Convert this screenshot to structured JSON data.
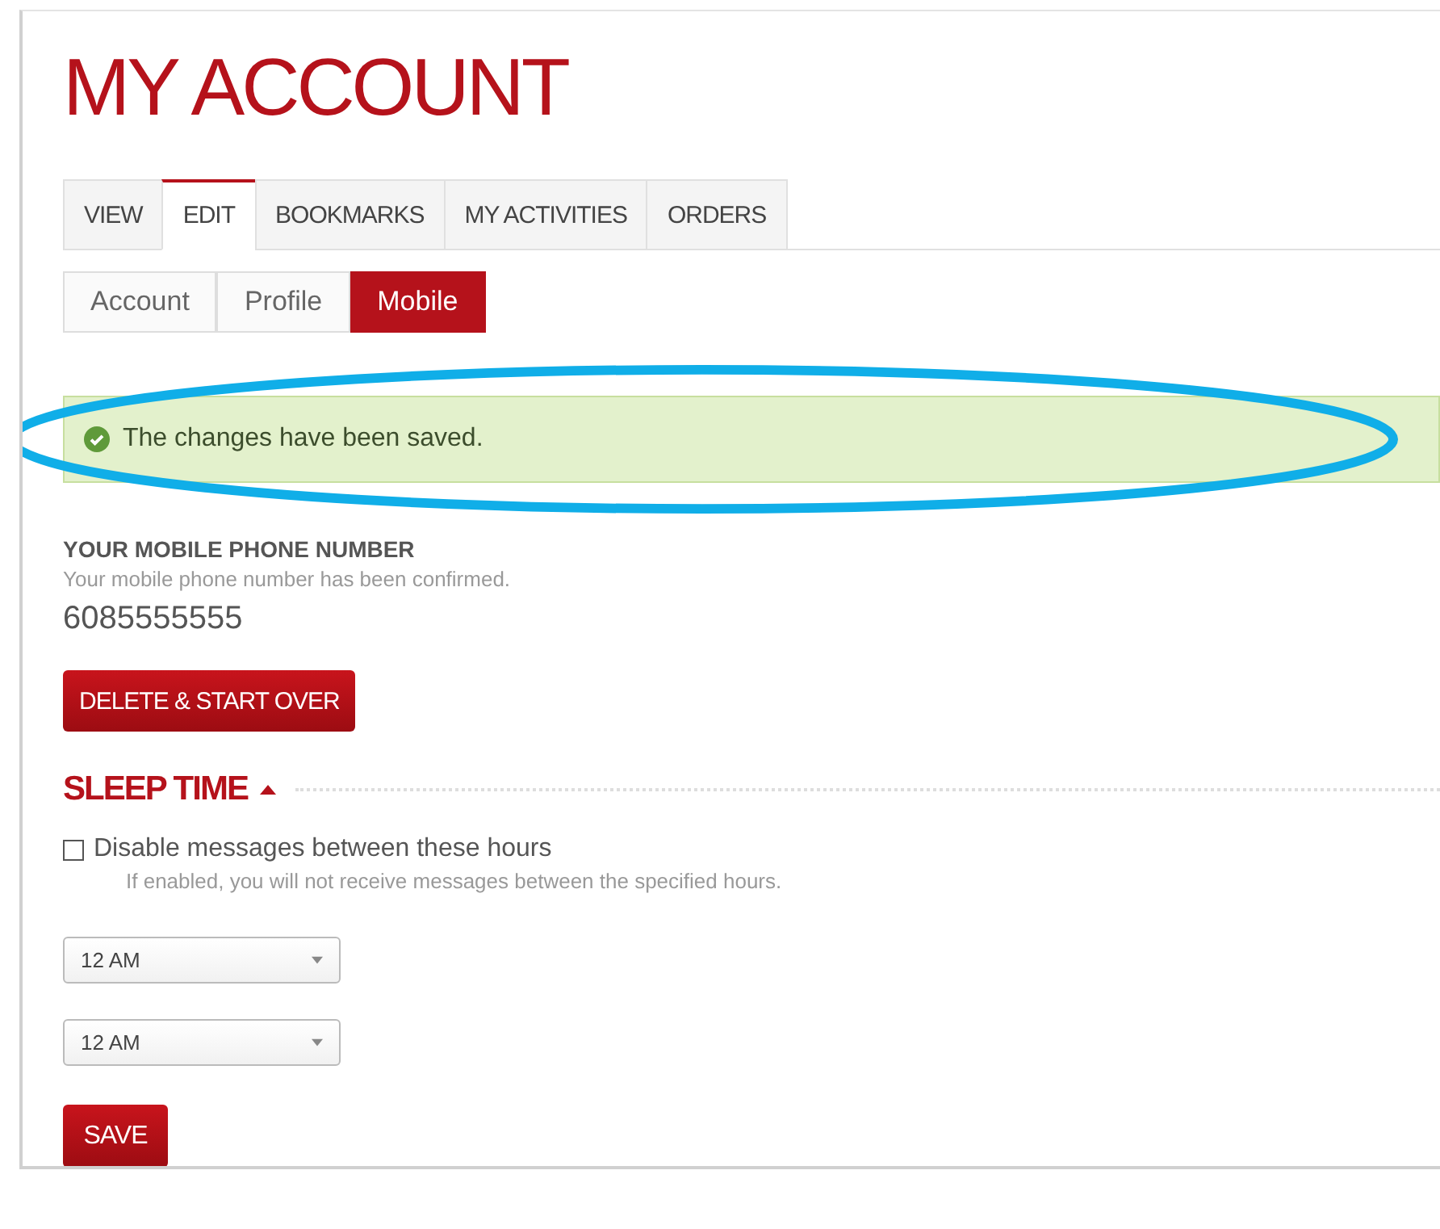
{
  "page": {
    "title": "MY ACCOUNT"
  },
  "tabs": [
    {
      "label": "VIEW",
      "selected": false
    },
    {
      "label": "EDIT",
      "selected": true
    },
    {
      "label": "BOOKMARKS",
      "selected": false
    },
    {
      "label": "MY ACTIVITIES",
      "selected": false
    },
    {
      "label": "ORDERS",
      "selected": false
    }
  ],
  "subtabs": [
    {
      "label": "Account",
      "selected": false
    },
    {
      "label": "Profile",
      "selected": false
    },
    {
      "label": "Mobile",
      "selected": true
    }
  ],
  "alert": {
    "message": "The changes have been saved.",
    "highlighted": true
  },
  "phone": {
    "heading": "YOUR MOBILE PHONE NUMBER",
    "help": "Your mobile phone number has been confirmed.",
    "number": "6085555555",
    "button": "DELETE & START OVER"
  },
  "sleep_time": {
    "heading": "SLEEP TIME",
    "expanded": true,
    "checkbox": {
      "label": "Disable messages between these hours",
      "checked": false,
      "help": "If enabled, you will not receive messages between the specified hours."
    },
    "selects": [
      {
        "value": "12 AM"
      },
      {
        "value": "12 AM"
      }
    ],
    "button": "SAVE"
  }
}
